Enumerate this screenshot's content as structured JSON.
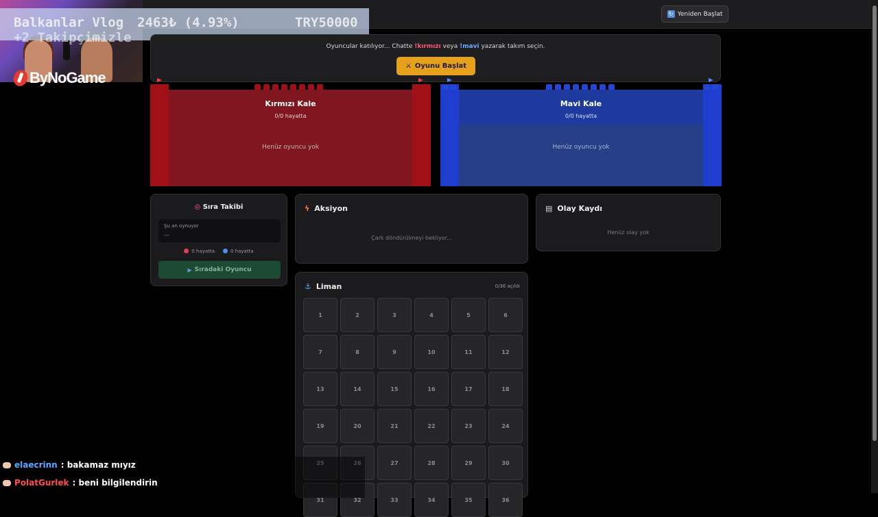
{
  "overlay": {
    "channel": "Balkanlar Vlog",
    "price": "2463₺ (4.93%)",
    "amount": "TRY50000",
    "followers": "+2 Takipçimizle",
    "logo": "ByNoGame"
  },
  "header": {
    "restart_label": "Yeniden Başlat",
    "restart_icon": "refresh-icon"
  },
  "banner": {
    "msg_prefix": "Oyuncular katılıyor... Chatte ",
    "red_cmd": "!kırmızı",
    "msg_mid": " veya ",
    "blue_cmd": "!mavi",
    "msg_suffix": " yazarak takım seçin.",
    "start_label": "Oyunu Başlat",
    "start_icon": "swords-icon"
  },
  "castles": {
    "red": {
      "name": "Kırmızı Kale",
      "lives": "0/0 hayatta",
      "empty": "Henüz oyuncu yok",
      "color": "#7f1620"
    },
    "blue": {
      "name": "Mavi Kale",
      "lives": "0/0 hayatta",
      "empty": "Henüz oyuncu yok",
      "color": "#1f3ea0"
    }
  },
  "turn": {
    "title": "Sıra Takibi",
    "icon": "target-icon",
    "now_label": "Şu an oynuyor",
    "now_value": "—",
    "red_alive": "0 hayatta",
    "blue_alive": "0 hayatta",
    "next_label": "Sıradaki Oyuncu",
    "next_icon": "play-icon"
  },
  "action": {
    "title": "Aksiyon",
    "icon": "lightning-icon",
    "waiting": "Çark döndürülmeyi bekliyor..."
  },
  "log": {
    "title": "Olay Kaydı",
    "icon": "clipboard-icon",
    "empty": "Henüz olay yok"
  },
  "port": {
    "title": "Liman",
    "icon": "anchor-icon",
    "count": "0/36 açıldı",
    "cells": [
      "1",
      "2",
      "3",
      "4",
      "5",
      "6",
      "7",
      "8",
      "9",
      "10",
      "11",
      "12",
      "13",
      "14",
      "15",
      "16",
      "17",
      "18",
      "19",
      "20",
      "21",
      "22",
      "23",
      "24",
      "25",
      "26",
      "27",
      "28",
      "29",
      "30",
      "31",
      "32",
      "33",
      "34",
      "35",
      "36"
    ]
  },
  "chat": [
    {
      "user": "elaecrinn",
      "message": " : bakamaz mıyız"
    },
    {
      "user": "PolatGurlek",
      "message": " : beni bilgilendirin"
    }
  ]
}
